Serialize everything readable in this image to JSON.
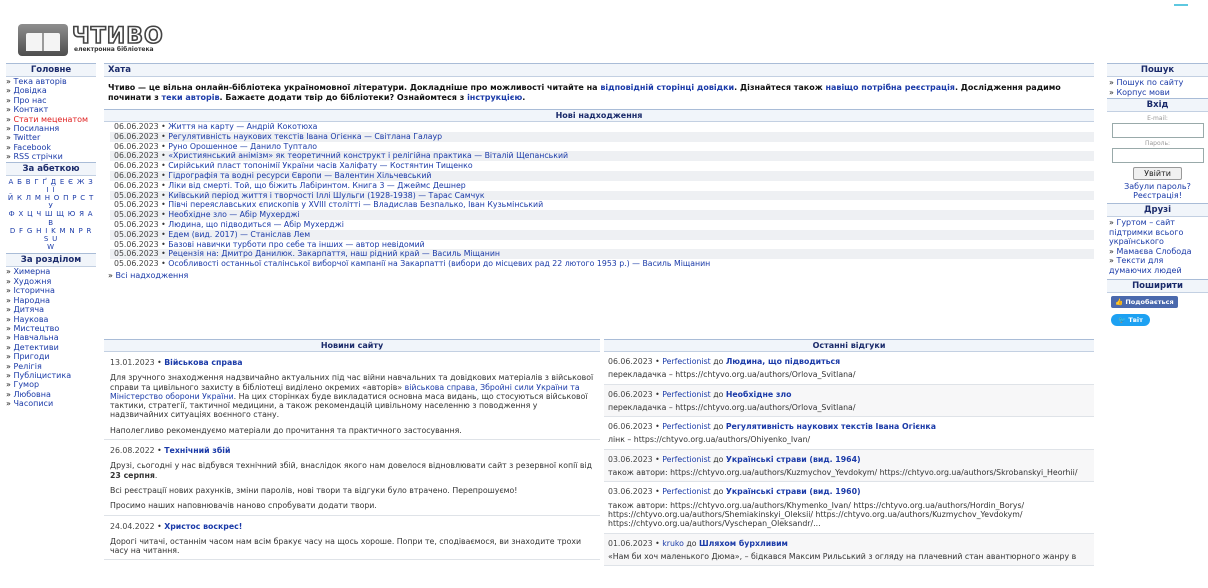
{
  "header": {
    "logo_title": "ЧТИВО",
    "logo_sub": "електронна бібліотека"
  },
  "left": {
    "main_title": "Головне",
    "main_items": [
      "Тека авторів",
      "Довідка",
      "Про нас",
      "Контакт",
      "Стати меценатом",
      "Посилання",
      "Twitter",
      "Facebook",
      "RSS стрічки"
    ],
    "alpha_title": "За абеткою",
    "alpha_lines": [
      "А Б В Г Ґ Д Е Є Ж З І Ї",
      "Й К Л М Н О П Р С Т У",
      "Ф Х Ц Ч Ш Щ Ю Я А В",
      "D F G H I K M N P R S U",
      "W"
    ],
    "section_title": "За розділом",
    "section_items": [
      "Химерна",
      "Художня",
      "Історична",
      "Народна",
      "Дитяча",
      "Наукова",
      "Мистецтво",
      "Навчальна",
      "Детективи",
      "Пригоди",
      "Релігія",
      "Публіцистика",
      "Гумор",
      "Любовна",
      "Часописи"
    ]
  },
  "main": {
    "crumb": "Хата",
    "intro": {
      "p1": "Чтиво — це вільна онлайн-бібліотека україномовної літератури. Докладніше про можливості читайте на ",
      "l1": "відповідній сторінці довідки",
      "p2": ". Дізнайтеся також ",
      "l2": "навіщо потрібна реєстрація",
      "p3": ". Дослідження радимо починати з ",
      "l3": "теки авторів",
      "p4": ". Бажаєте додати твір до бібліотеки? Ознайомтеся з ",
      "l4": "інструкцією",
      "p5": "."
    },
    "new_title": "Нові надходження",
    "new_items": [
      {
        "date": "06.06.2023",
        "text": "Життя на карту — Андрій Кокотюха"
      },
      {
        "date": "06.06.2023",
        "text": "Регулятивність наукових текстів Івана Огієнка — Світлана Галаур"
      },
      {
        "date": "06.06.2023",
        "text": "Руно Орошенное — Данило Туптало"
      },
      {
        "date": "06.06.2023",
        "text": "«Християнський анімізм» як теоретичний конструкт і релігійна практика — Віталій Щепанський"
      },
      {
        "date": "06.06.2023",
        "text": "Сирійський пласт топонімії України часів Халіфату — Костянтин Тищенко"
      },
      {
        "date": "06.06.2023",
        "text": "Гідрографія та водні ресурси Європи — Валентин Хільчевський"
      },
      {
        "date": "06.06.2023",
        "text": "Ліки від смерті. Той, що біжить Лабіринтом. Книга 3 — Джеймс Дешнер"
      },
      {
        "date": "05.06.2023",
        "text": "Київський період життя і творчості Іллі Шульги (1928-1938) — Тарас Самчук"
      },
      {
        "date": "05.06.2023",
        "text": "Півчі переяславських єпископів у XVIII столітті — Владислав Безпалько, Іван Кузьмінський"
      },
      {
        "date": "05.06.2023",
        "text": "Необхідне зло — Абір Мухерджі"
      },
      {
        "date": "05.06.2023",
        "text": "Людина, що підводиться — Абір Мухерджі"
      },
      {
        "date": "05.06.2023",
        "text": "Едем (вид. 2017) — Станіслав Лем"
      },
      {
        "date": "05.06.2023",
        "text": "Базові навички турботи про себе та інших — автор невідомий"
      },
      {
        "date": "05.06.2023",
        "text": "Рецензія на: Дмитро Данилюк. Закарпаття, наш рідний край — Василь Міщанин"
      },
      {
        "date": "05.06.2023",
        "text": "Особливості останньої сталінської виборчої кампанії на Закарпатті (вибори до місцевих рад 22 лютого 1953 р.) — Василь Міщанин"
      }
    ],
    "all_new": "Всі надходження",
    "news_title": "Новини сайту",
    "news": [
      {
        "date": "13.01.2023",
        "title": "Військова справа",
        "t1": "Для зручного знаходження надзвичайно актуальних під час війни навчальних та довідкових матеріалів з військової справи та цивільного захисту в бібліотеці виділено окремих «авторів» ",
        "l1": "військова справа, Збройні сили України та Міністерство оборони України",
        "t2": ". На цих сторінках буде викладатися основна маса видань, що стосуються військової тактики, стратегії, тактичної медицини, а також рекомендацій цивільному населенню з поводження у надзвичайних ситуаціях воєнного стану.",
        "t3": "Наполегливо рекомендуємо матеріали до прочитання та практичного застосування."
      },
      {
        "date": "26.08.2022",
        "title": "Технічний збій",
        "t1": "Друзі, сьогодні у нас відбувся технічний збій, внаслідок якого нам довелося відновлювати сайт з резервної копії від ",
        "b1": "23 серпня",
        "t2": "Всі реєстрації нових рахунків, зміни паролів, нові твори та відгуки було втрачено. Перепрошуємо!",
        "t3": "Просимо наших наповнювачів наново спробувати додати твори."
      },
      {
        "date": "24.04.2022",
        "title": "Христос воскрес!",
        "t1": "Дорогі читачі, останнім часом нам всім бракує часу на щось хороше. Попри те, сподіваємося, ви знаходите трохи часу на читання."
      }
    ],
    "reviews_title": "Останні відгуки",
    "reviews": [
      {
        "date": "06.06.2023",
        "user": "Perfectionist",
        "to": "до",
        "work": "Людина, що підводиться",
        "text": "перекладачка – https://chtyvo.org.ua/authors/Orlova_Svitlana/"
      },
      {
        "date": "06.06.2023",
        "user": "Perfectionist",
        "to": "до",
        "work": "Необхідне зло",
        "text": "перекладачка – https://chtyvo.org.ua/authors/Orlova_Svitlana/"
      },
      {
        "date": "06.06.2023",
        "user": "Perfectionist",
        "to": "до",
        "work": "Регулятивність наукових текстів Івана Огієнка",
        "text": "лінк – https://chtyvo.org.ua/authors/Ohiyenko_Ivan/"
      },
      {
        "date": "03.06.2023",
        "user": "Perfectionist",
        "to": "до",
        "work": "Українські страви (вид. 1964)",
        "text": "також автори: https://chtyvo.org.ua/authors/Kuzmychov_Yevdokym/ https://chtyvo.org.ua/authors/Skrobanskyi_Heorhii/"
      },
      {
        "date": "03.06.2023",
        "user": "Perfectionist",
        "to": "до",
        "work": "Українські страви (вид. 1960)",
        "text": "також автори: https://chtyvo.org.ua/authors/Khymenko_Ivan/ https://chtyvo.org.ua/authors/Hordin_Borys/ https://chtyvo.org.ua/authors/Shemiakinskyi_Oleksii/ https://chtyvo.org.ua/authors/Kuzmychov_Yevdokym/ https://chtyvo.org.ua/authors/Vyschepan_Oleksandr/..."
      },
      {
        "date": "01.06.2023",
        "user": "kruko",
        "to": "до",
        "work": "Шляхом бурхливим",
        "text": "«Нам би хоч маленького Дюма», – бідкався Максим Рильський з огляду на плачевний стан авантюрного жанру в"
      }
    ]
  },
  "right": {
    "search_title": "Пошук",
    "search_items": [
      "Пошук по сайту",
      "Корпус мови"
    ],
    "login_title": "Вхід",
    "email_label": "E-mail:",
    "password_label": "Пароль:",
    "login_button": "Увійти",
    "forgot": "Забули пароль?",
    "register": "Реєстрація!",
    "friends_title": "Друзі",
    "friends": [
      "Гуртом – сайт підтримки всього українського",
      "Мамаєва Слобода",
      "Тексти для думаючих людей"
    ],
    "share_title": "Поширити",
    "fb_label": "Подобається",
    "tw_label": "Твіт"
  }
}
